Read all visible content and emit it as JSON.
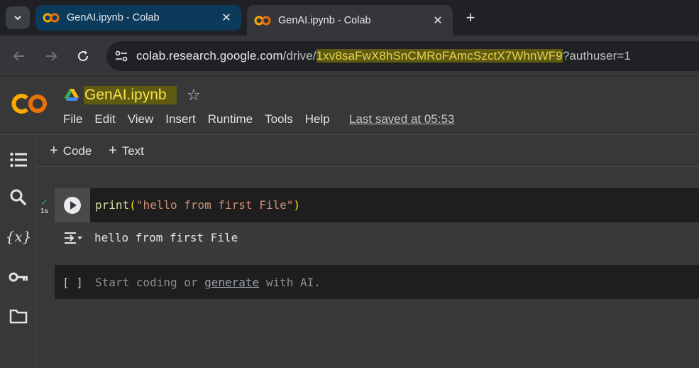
{
  "browser": {
    "tabs": [
      {
        "title": "GenAI.ipynb - Colab",
        "active": false
      },
      {
        "title": "GenAI.ipynb - Colab",
        "active": true
      }
    ],
    "url": {
      "prefix": "colab.research.google.com",
      "path": "/drive/",
      "highlighted": "1xv8saFwX8hSnCMRoFAmcSzctX7WhnWF9",
      "query": "?authuser=1"
    }
  },
  "notebook": {
    "title": "GenAI.ipynb",
    "menu": [
      "File",
      "Edit",
      "View",
      "Insert",
      "Runtime",
      "Tools",
      "Help"
    ],
    "last_saved": "Last saved at 05:53"
  },
  "insert_bar": {
    "code_label": "Code",
    "text_label": "Text"
  },
  "cells": {
    "code": {
      "fn": "print",
      "open_paren": "(",
      "string": "\"hello from first File\"",
      "close_paren": ")",
      "exec_time": "1s",
      "output": "hello from first File"
    },
    "empty": {
      "bracket": "[ ]",
      "placeholder_before": "Start coding or ",
      "placeholder_link": "generate",
      "placeholder_after": " with AI."
    }
  },
  "colors": {
    "highlight_bg": "#5f5a12",
    "highlight_fg": "#f7e14b",
    "success": "#34a853",
    "colab_orange": "#f9ab00"
  }
}
